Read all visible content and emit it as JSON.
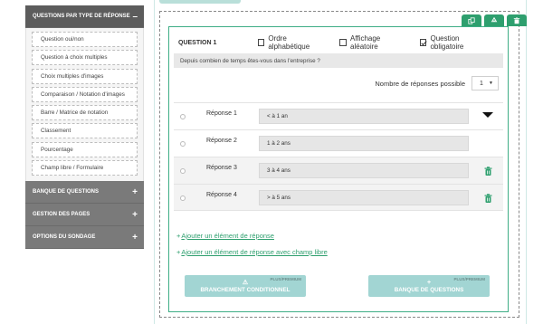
{
  "sidebar": {
    "question_types": {
      "title": "QUESTIONS PAR TYPE DE RÉPONSE",
      "toggle": "–",
      "items": [
        {
          "label": "Question oui/non"
        },
        {
          "label": "Question à choix multiples"
        },
        {
          "label": "Choix multiples d'images"
        },
        {
          "label": "Comparaison / Notation d'images"
        },
        {
          "label": "Barre / Matrice de notation"
        },
        {
          "label": "Classement"
        },
        {
          "label": "Pourcentage"
        },
        {
          "label": "Champ libre / Formulaire"
        }
      ]
    },
    "sections": [
      {
        "title": "BANQUE DE QUESTIONS",
        "toggle": "+"
      },
      {
        "title": "GESTION DES PAGES",
        "toggle": "+"
      },
      {
        "title": "OPTIONS DU SONDAGE",
        "toggle": "+"
      }
    ]
  },
  "question": {
    "label": "QUESTION 1",
    "options": {
      "alphabetical": {
        "label": "Ordre alphabétique",
        "checked": false
      },
      "random": {
        "label": "Affichage aléatoire",
        "checked": false
      },
      "mandatory": {
        "label": "Question obligatoire",
        "checked": true
      }
    },
    "text": "Depuis combien de temps êtes-vous  dans l'entreprise ?",
    "responses_count_label": "Nombre de réponses possible",
    "responses_count_value": "1",
    "responses": [
      {
        "label": "Réponse 1",
        "value": "<  à 1 an"
      },
      {
        "label": "Réponse 2",
        "value": "1 à 2 ans"
      },
      {
        "label": "Réponse 3",
        "value": "3 à 4 ans"
      },
      {
        "label": "Réponse 4",
        "value": "> à 5 ans"
      }
    ],
    "add_response": "Ajouter un élément de réponse",
    "add_response_free": "Ajouter un élément de réponse avec champ libre",
    "add_prefix": "+"
  },
  "buttons": {
    "branching": {
      "label": "BRANCHEMENT CONDITIONNEL",
      "tag": "PLUS/PREMIUM",
      "icon": "⚠"
    },
    "bank": {
      "label": "BANQUE DE QUESTIONS",
      "tag": "PLUS/PREMIUM",
      "icon": "+"
    }
  },
  "icons": {
    "copy": "copy-icon",
    "recycle": "recycle-icon",
    "trash": "trash-icon",
    "caret": "caret-down-icon"
  },
  "colors": {
    "accent": "#2e9f6e",
    "card_border": "#3fae86",
    "sidebar_header": "#7a7a7a",
    "button_bg": "#a2d5d3"
  }
}
